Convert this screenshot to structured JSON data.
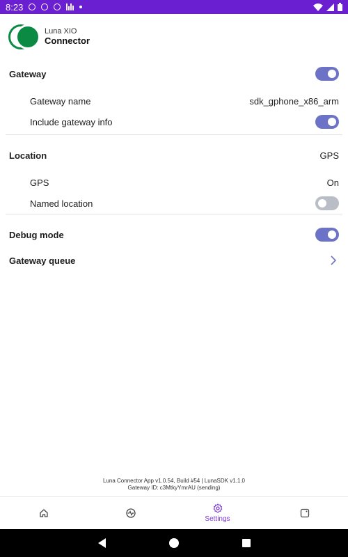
{
  "status_bar": {
    "time": "8:23"
  },
  "app": {
    "brand_top": "Luna XIO",
    "brand_bottom": "Connector"
  },
  "settings": {
    "gateway": {
      "label": "Gateway",
      "enabled": true
    },
    "gateway_name": {
      "label": "Gateway name",
      "value": "sdk_gphone_x86_arm"
    },
    "include_gateway_info": {
      "label": "Include gateway info",
      "enabled": true
    },
    "location": {
      "label": "Location",
      "value": "GPS"
    },
    "gps": {
      "label": "GPS",
      "value": "On"
    },
    "named_location": {
      "label": "Named location",
      "enabled": false
    },
    "debug_mode": {
      "label": "Debug mode",
      "enabled": true
    },
    "gateway_queue": {
      "label": "Gateway queue"
    }
  },
  "footer": {
    "version": "Luna Connector App v1.0.54, Build #54 | LunaSDK v1.1.0",
    "gateway_id": "Gateway ID: c3MtkyYmrAU (sending)"
  },
  "bottom_nav": {
    "items": [
      {
        "icon": "home-icon",
        "label": ""
      },
      {
        "icon": "activity-icon",
        "label": ""
      },
      {
        "icon": "settings-icon",
        "label": "Settings",
        "active": true
      },
      {
        "icon": "device-icon",
        "label": ""
      }
    ]
  },
  "colors": {
    "accent": "#6c73c6",
    "status_bar": "#6a1fd0",
    "brand_green": "#0b8a43",
    "active_nav": "#7a36d6"
  }
}
